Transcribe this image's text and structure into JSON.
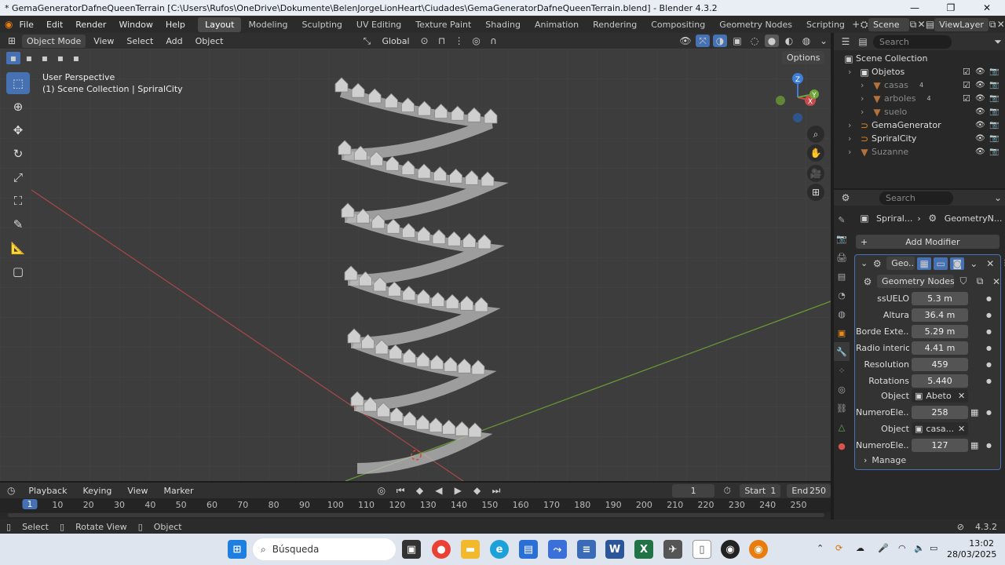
{
  "window": {
    "title": "* GemaGeneratorDafneQueenTerrain [C:\\Users\\Rufos\\OneDrive\\Dokumente\\BelenJorgeLionHeart\\Ciudades\\GemaGeneratorDafneQueenTerrain.blend] - Blender 4.3.2",
    "minimize": "—",
    "maximize": "❐",
    "close": "✕"
  },
  "menubar": {
    "menus": [
      "File",
      "Edit",
      "Render",
      "Window",
      "Help"
    ],
    "workspaces": [
      "Layout",
      "Modeling",
      "Sculpting",
      "UV Editing",
      "Texture Paint",
      "Shading",
      "Animation",
      "Rendering",
      "Compositing",
      "Geometry Nodes",
      "Scripting"
    ],
    "active_workspace": "Layout",
    "scene": "Scene",
    "view_layer": "ViewLayer"
  },
  "viewport_header": {
    "mode": "Object Mode",
    "menus": [
      "View",
      "Select",
      "Add",
      "Object"
    ],
    "orientation": "Global",
    "options": "Options"
  },
  "viewport": {
    "line1": "User Perspective",
    "line2": "(1) Scene Collection | SpriralCity",
    "gizmo_axes": [
      "Z",
      "X",
      "Y"
    ],
    "accent_select": "#4672b3",
    "axis_x_color": "#c84b4b",
    "axis_y_color": "#6fa43a",
    "axis_z_color": "#3c7ed8"
  },
  "outliner": {
    "search_placeholder": "Search",
    "root": "Scene Collection",
    "items": [
      {
        "label": "Objetos",
        "indent": 1,
        "checked": true
      },
      {
        "label": "casas",
        "indent": 2,
        "badge": "4",
        "checked": true,
        "dim": true
      },
      {
        "label": "arboles",
        "indent": 2,
        "badge": "4",
        "checked": true,
        "dim": true
      },
      {
        "label": "suelo",
        "indent": 2,
        "dim": true
      },
      {
        "label": "GemaGenerator",
        "indent": 1
      },
      {
        "label": "SpriralCity",
        "indent": 1
      },
      {
        "label": "Suzanne",
        "indent": 1,
        "dim": true
      }
    ]
  },
  "properties": {
    "search_placeholder": "Search",
    "breadcrumb_object": "Spriral...",
    "breadcrumb_modifier": "GeometryN...",
    "add_modifier": "Add Modifier",
    "modifier_name": "Geo...",
    "node_group": "Geometry Nodes...",
    "fields": [
      {
        "label": "ssUELO",
        "value": "5.3 m"
      },
      {
        "label": "Altura",
        "value": "36.4 m"
      },
      {
        "label": "Borde Exte...",
        "value": "5.29 m"
      },
      {
        "label": "Radio interior",
        "value": "4.41 m"
      },
      {
        "label": "Resolution",
        "value": "459"
      },
      {
        "label": "Rotations",
        "value": "5.440"
      }
    ],
    "object1_label": "Object",
    "object1_value": "Abeto",
    "numero1_label": "NumeroEle...",
    "numero1_value": "258",
    "object2_label": "Object",
    "object2_value": "casa...",
    "numero2_label": "NumeroEle...",
    "numero2_value": "127",
    "manage": "Manage"
  },
  "timeline": {
    "menus": [
      "Playback",
      "Keying",
      "View",
      "Marker"
    ],
    "current_frame": "1",
    "start_label": "Start",
    "start": "1",
    "end_label": "End",
    "end": "250",
    "ticks": [
      "1",
      "10",
      "20",
      "30",
      "40",
      "50",
      "60",
      "70",
      "80",
      "90",
      "100",
      "110",
      "120",
      "130",
      "140",
      "150",
      "160",
      "170",
      "180",
      "190",
      "200",
      "210",
      "220",
      "230",
      "240",
      "250"
    ]
  },
  "statusbar": {
    "select": "Select",
    "rotate": "Rotate View",
    "object": "Object",
    "version": "4.3.2"
  },
  "taskbar": {
    "search": "Búsqueda",
    "time": "13:02",
    "date": "28/03/2025"
  }
}
